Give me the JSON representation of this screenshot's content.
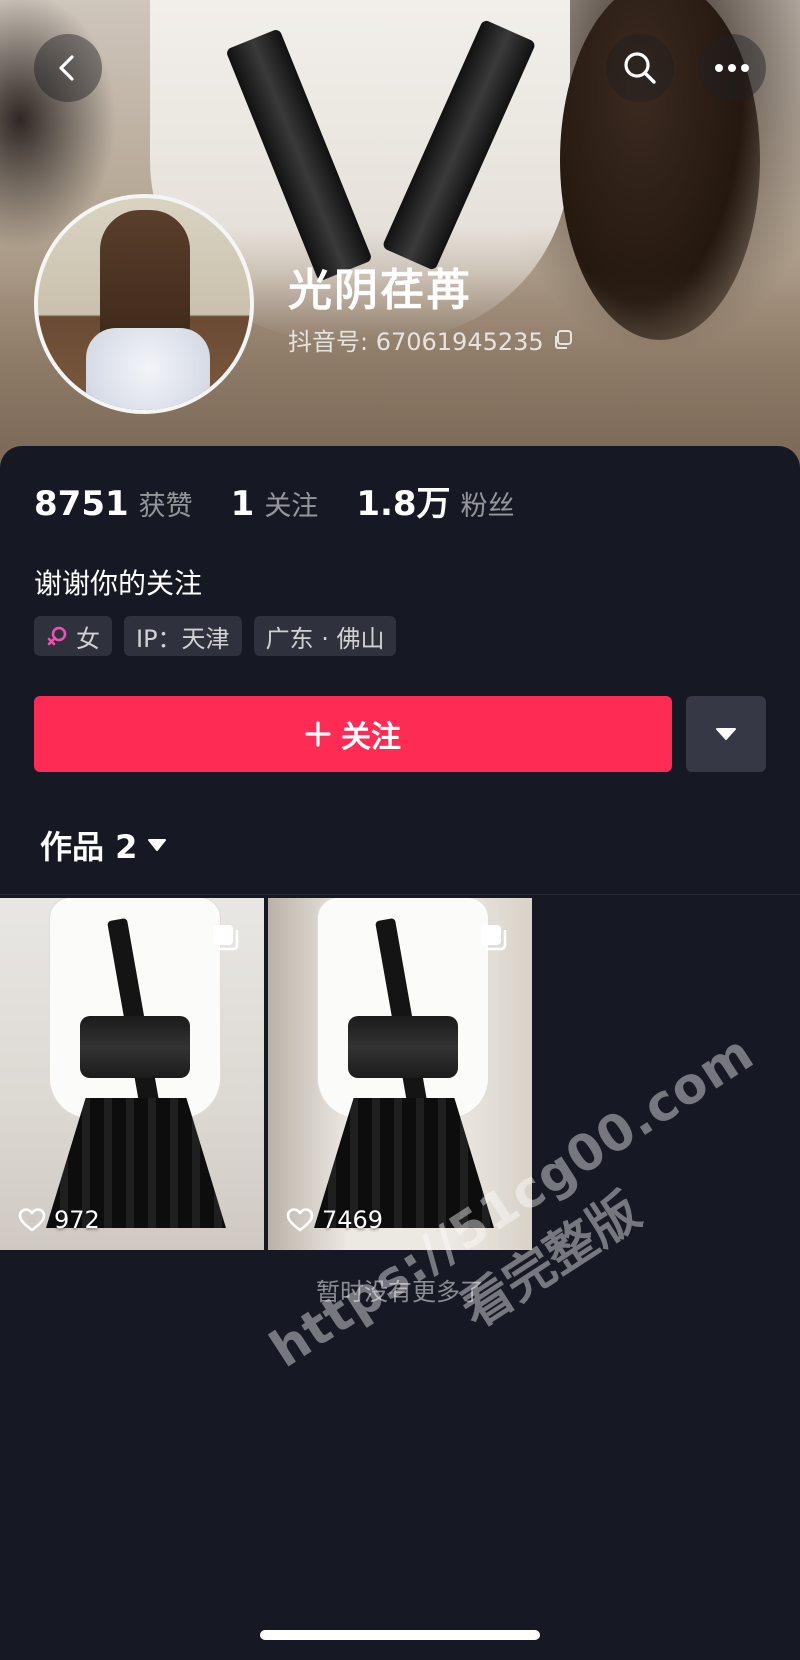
{
  "profile": {
    "nickname": "光阴荏苒",
    "douyin_id": "抖音号: 67061945235",
    "bio": "谢谢你的关注"
  },
  "stats": [
    {
      "value": "8751",
      "label": "获赞"
    },
    {
      "value": "1",
      "label": "关注"
    },
    {
      "value": "1.8万",
      "label": "粉丝"
    }
  ],
  "tags": {
    "gender": "女",
    "ip": "IP：天津",
    "location": "广东 · 佛山"
  },
  "actions": {
    "follow_label": "关注",
    "follow_color": "#fe2c55"
  },
  "works": {
    "tab_label": "作品 2",
    "items": [
      {
        "likes": "972"
      },
      {
        "likes": "7469"
      }
    ],
    "end_text": "暂时没有更多了"
  },
  "watermark": {
    "url": "https://51cg00.com",
    "text": "看完整版"
  },
  "icons": {
    "back": "back-chevron-icon",
    "search": "search-icon",
    "more": "more-dots-icon",
    "copy": "copy-icon",
    "gender": "female-icon",
    "dropdown": "caret-down-icon",
    "multi_image": "multi-image-icon",
    "heart": "heart-icon"
  }
}
